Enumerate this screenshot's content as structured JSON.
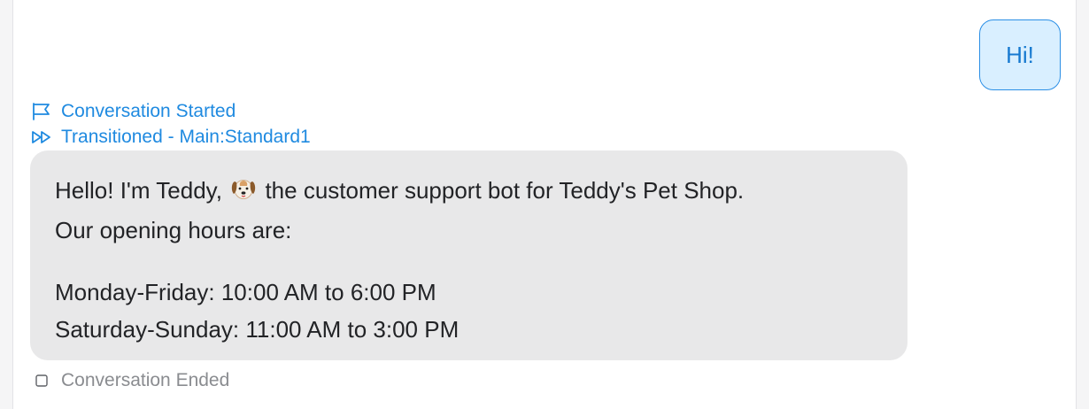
{
  "user_message": {
    "text": "Hi!"
  },
  "events": {
    "started": {
      "icon": "flag-icon",
      "label": "Conversation Started"
    },
    "transition": {
      "icon": "fast-forward-icon",
      "label": "Transitioned - Main:Standard1"
    },
    "ended": {
      "icon": "stop-square-icon",
      "label": "Conversation Ended"
    }
  },
  "bot_message": {
    "line1_before_emoji": "Hello! I'm Teddy,",
    "emoji_icon": "dog-face-icon",
    "line1_after_emoji": "the customer support bot for Teddy's Pet Shop.",
    "line2": "Our opening hours are:",
    "line3": "Monday-Friday: 10:00 AM to 6:00 PM",
    "line4": "Saturday-Sunday: 11:00 AM to 3:00 PM"
  },
  "colors": {
    "accent": "#1f8ae0",
    "user_bubble_bg": "#d9efff",
    "user_bubble_border": "#2b8fe6",
    "bot_bubble_bg": "#e8e8e9",
    "muted_text": "#8a8c90"
  }
}
